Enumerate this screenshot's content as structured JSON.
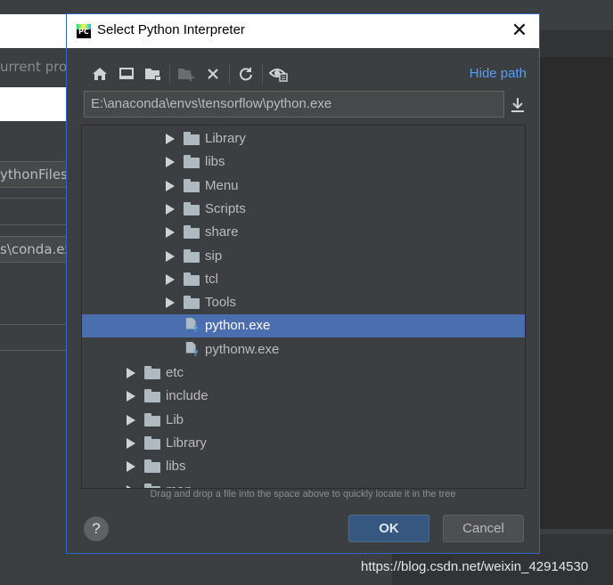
{
  "background": {
    "texts": [
      "urrent proj",
      "ythonFiles",
      "s\\conda.ex"
    ]
  },
  "dialog": {
    "title": "Select Python Interpreter",
    "hide_path_label": "Hide path",
    "path_value": "E:\\anaconda\\envs\\tensorflow\\python.exe",
    "toolbar_icons": [
      "home-icon",
      "desktop-icon",
      "project-folder-icon",
      "new-folder-icon",
      "delete-icon",
      "refresh-icon",
      "show-hidden-icon"
    ],
    "tree": [
      {
        "label": "Library",
        "kind": "folder",
        "depth": 2
      },
      {
        "label": "libs",
        "kind": "folder",
        "depth": 2
      },
      {
        "label": "Menu",
        "kind": "folder",
        "depth": 2
      },
      {
        "label": "Scripts",
        "kind": "folder",
        "depth": 2
      },
      {
        "label": "share",
        "kind": "folder",
        "depth": 2
      },
      {
        "label": "sip",
        "kind": "folder",
        "depth": 2
      },
      {
        "label": "tcl",
        "kind": "folder",
        "depth": 2
      },
      {
        "label": "Tools",
        "kind": "folder",
        "depth": 2
      },
      {
        "label": "python.exe",
        "kind": "file",
        "depth": 2,
        "selected": true
      },
      {
        "label": "pythonw.exe",
        "kind": "file",
        "depth": 2
      },
      {
        "label": "etc",
        "kind": "folder",
        "depth": 1
      },
      {
        "label": "include",
        "kind": "folder",
        "depth": 1
      },
      {
        "label": "Lib",
        "kind": "folder",
        "depth": 1
      },
      {
        "label": "Library",
        "kind": "folder",
        "depth": 1
      },
      {
        "label": "libs",
        "kind": "folder",
        "depth": 1
      },
      {
        "label": "man",
        "kind": "folder",
        "depth": 1
      }
    ],
    "hint": "Drag and drop a file into the space above to quickly locate it in the tree",
    "help_label": "?",
    "ok_label": "OK",
    "cancel_label": "Cancel"
  },
  "watermark": "https://blog.csdn.net/weixin_42914530",
  "colors": {
    "accent": "#589df6",
    "selection": "#4b6eaf",
    "dialog_bg": "#3c3f41",
    "ok_bg": "#365880"
  }
}
